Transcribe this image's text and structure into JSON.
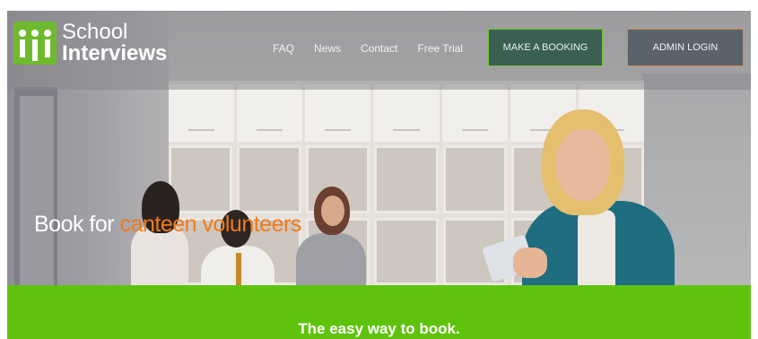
{
  "brand": {
    "line1": "School",
    "line2": "Interviews",
    "color": "#6fb92e"
  },
  "nav": {
    "items": [
      {
        "label": "FAQ"
      },
      {
        "label": "News"
      },
      {
        "label": "Contact"
      },
      {
        "label": "Free Trial"
      }
    ],
    "booking_button": "MAKE A BOOKING",
    "admin_button": "ADMIN LOGIN"
  },
  "hero": {
    "headline_prefix": "Book for ",
    "headline_highlight": "canteen volunteers",
    "highlight_color": "#f07a1a"
  },
  "band": {
    "tagline": "The easy way to book.",
    "color": "#5fc30e"
  }
}
